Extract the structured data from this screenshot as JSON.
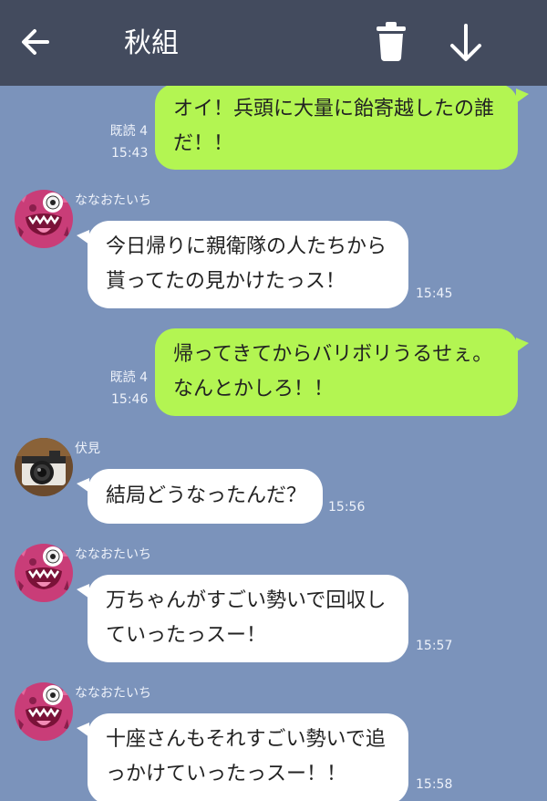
{
  "header": {
    "title": "秋組",
    "back_icon": "arrow-left-icon",
    "trash_icon": "trash-icon",
    "download_icon": "arrow-down-icon"
  },
  "messages": [
    {
      "direction": "out",
      "lines": [
        "オイ！兵頭に大量に飴寄越したの誰",
        "だ！！"
      ],
      "read": "既読 4",
      "time": "15:43"
    },
    {
      "direction": "in",
      "sender": "ななおたいち",
      "avatar": "monster-avatar",
      "lines": [
        "今日帰りに親衛隊の人たちから",
        "貰ってたの見かけたっス！"
      ],
      "time": "15:45"
    },
    {
      "direction": "out",
      "lines": [
        "帰ってきてからバリボリうるせぇ。",
        "なんとかしろ！！"
      ],
      "read": "既読 4",
      "time": "15:46"
    },
    {
      "direction": "in",
      "sender": "伏見",
      "avatar": "camera-avatar",
      "lines": [
        "結局どうなったんだ？"
      ],
      "time": "15:56"
    },
    {
      "direction": "in",
      "sender": "ななおたいち",
      "avatar": "monster-avatar",
      "lines": [
        "万ちゃんがすごい勢いで回収し",
        "ていったっスー！"
      ],
      "time": "15:57"
    },
    {
      "direction": "in",
      "sender": "ななおたいち",
      "avatar": "monster-avatar",
      "lines": [
        "十座さんもそれすごい勢いで追",
        "っかけていったっスー！！"
      ],
      "time": "15:58"
    }
  ],
  "colors": {
    "background": "#7b93bb",
    "header": "#434b5e",
    "outgoing_bubble": "#b3f552",
    "incoming_bubble": "#ffffff",
    "monster_avatar": "#c93d78"
  }
}
